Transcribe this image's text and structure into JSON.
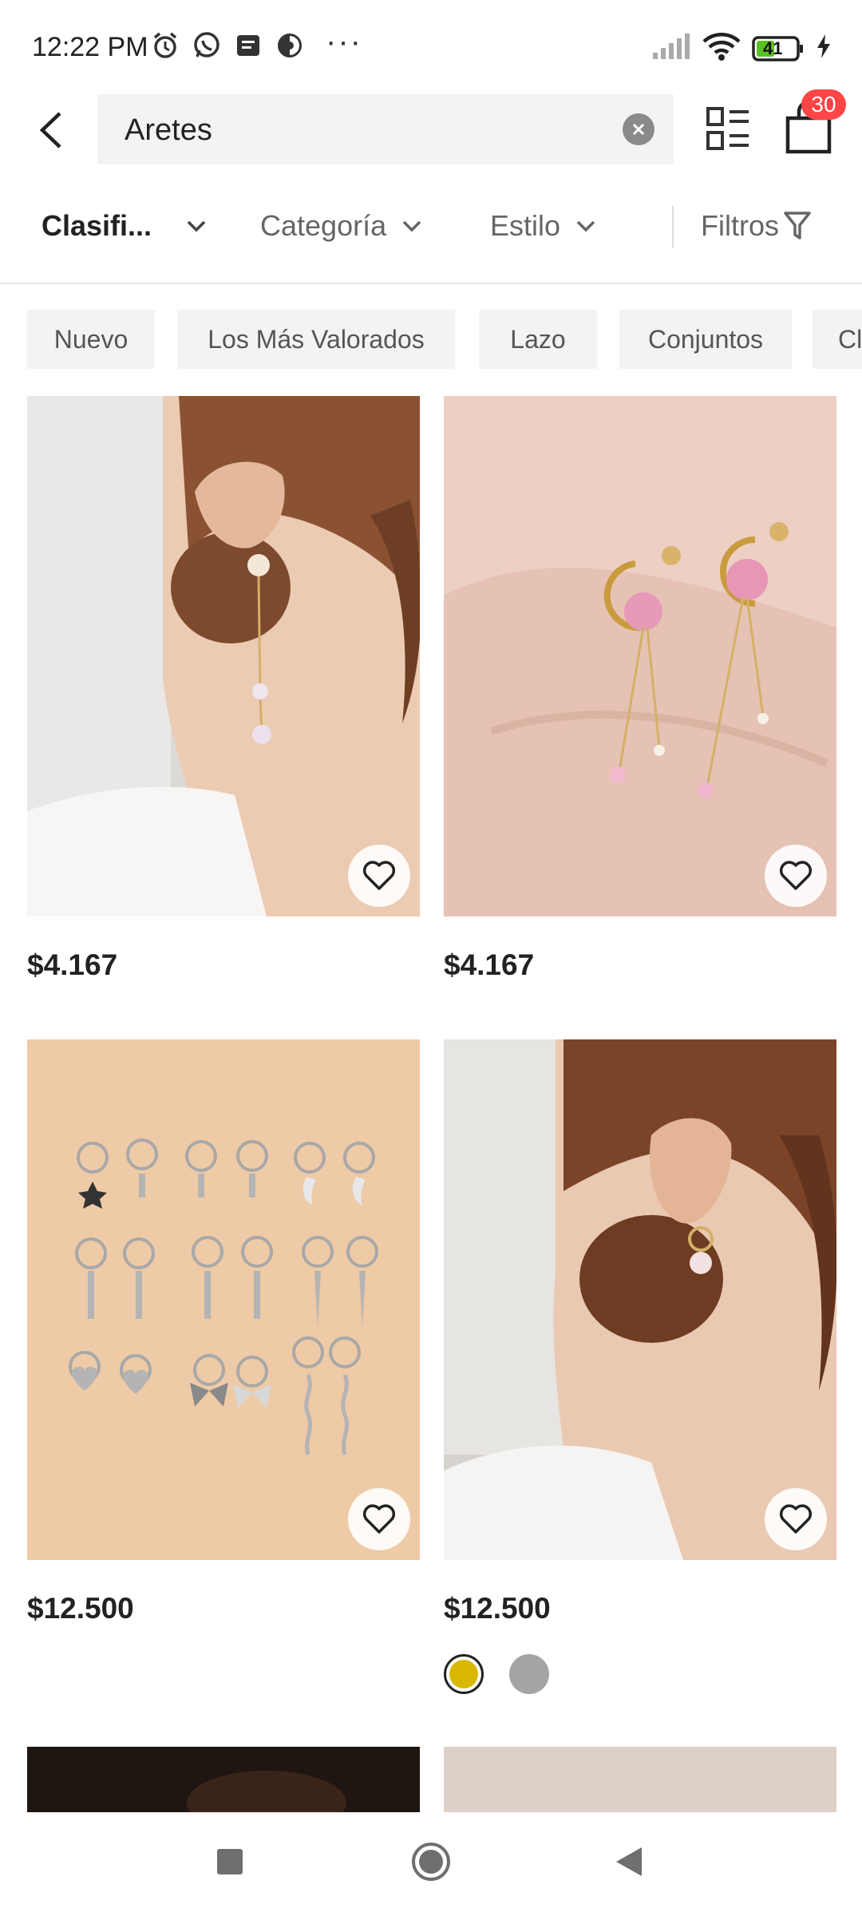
{
  "status_bar": {
    "time": "12:22 PM",
    "more": "···",
    "battery": "41",
    "icons": [
      "alarm-icon",
      "whatsapp-icon",
      "message-icon",
      "app-icon",
      "signal-icon",
      "wifi-icon",
      "battery-icon",
      "charging-icon"
    ]
  },
  "search": {
    "query": "Aretes"
  },
  "header": {
    "bag_count": "30"
  },
  "filters": {
    "sort_label": "Clasifi...",
    "category_label": "Categoría",
    "style_label": "Estilo",
    "filters_label": "Filtros"
  },
  "chips": [
    "Nuevo",
    "Los Más Valorados",
    "Lazo",
    "Conjuntos",
    "Cl"
  ],
  "products": [
    {
      "price": "$4.167"
    },
    {
      "price": "$4.167"
    },
    {
      "price": "$12.500"
    },
    {
      "price": "$12.500",
      "swatches": [
        "#d8b800",
        "#a6a3a3"
      ]
    }
  ],
  "colors": {
    "badge": "#ff4545",
    "chip_bg": "#f3f3f3",
    "search_bg": "#f3f3f3"
  }
}
